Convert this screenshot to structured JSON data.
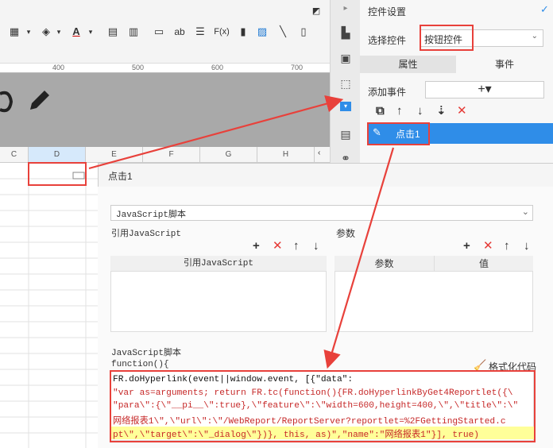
{
  "left_toolbar": {
    "ab_label": "ab",
    "fx_label": "F(x)"
  },
  "ruler": {
    "ticks": [
      "400",
      "500",
      "600",
      "700"
    ]
  },
  "columns": [
    "C",
    "D",
    "E",
    "F",
    "G",
    "H"
  ],
  "properties": {
    "title": "控件设置",
    "select_label": "选择控件",
    "select_value": "按钮控件",
    "tab_props": "属性",
    "tab_events": "事件",
    "add_event_label": "添加事件",
    "add_event_btn": "+▾",
    "event_item": "点击1"
  },
  "dialog": {
    "title": "点击1",
    "script_type": "JavaScript脚本",
    "ref_js_label": "引用JavaScript",
    "ref_js_col": "引用JavaScript",
    "param_label": "参数",
    "param_col1": "参数",
    "param_col2": "值",
    "script_label": "JavaScript脚本",
    "function_header": "function(){",
    "format_btn": "格式化代码",
    "code_line1": "FR.doHyperlink(event||window.event, [{\"data\":",
    "code_line2": "\"var as=arguments; return FR.tc(function(){FR.doHyperlinkByGet4Reportlet({\\",
    "code_line3": "\"para\\\":{\\\"__pi__\\\":true},\\\"feature\\\":\\\"width=600,height=400,\\\",\\\"title\\\":\\\"",
    "code_line4": "网络报表1\\\",\\\"url\\\":\\\"/WebReport/ReportServer?reportlet=%2FGettingStarted.c",
    "code_line5": "pt\\\",\\\"target\\\":\\\"_dialog\\\"})}, this, as)\",\"name\":\"网络报表1\"}], true)"
  },
  "colors": {
    "accent_blue": "#2f8de8",
    "highlight_red": "#e8413b",
    "code_red": "#c62828",
    "code_highlight": "#ffff99"
  }
}
